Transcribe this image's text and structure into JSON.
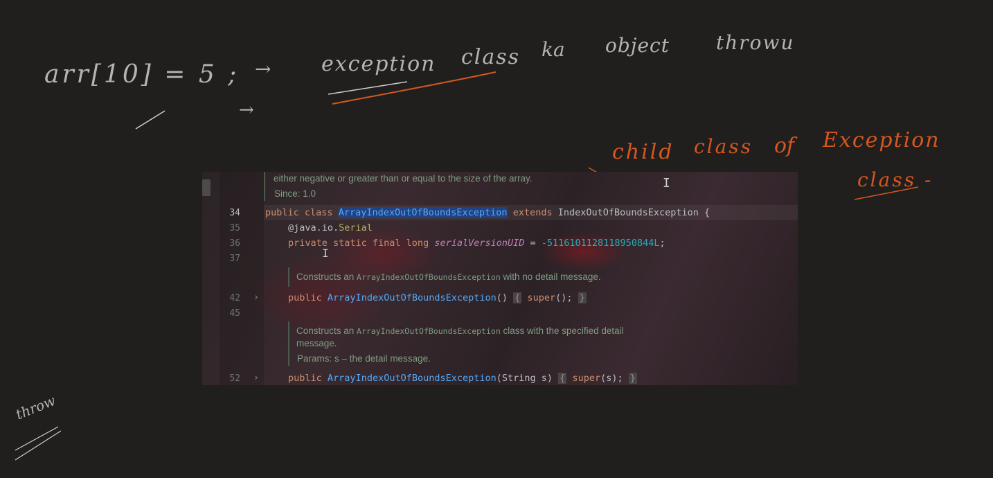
{
  "handwriting": {
    "line1_left": "arr[10] = 5 ;",
    "arrow": "→",
    "exception": "exception",
    "class": "class",
    "ka": "ka",
    "object": "object",
    "thrown": "throwu",
    "child": "child",
    "class2": "class",
    "of": "of",
    "Exception": "Exception",
    "class3": "class -",
    "throw": "throw"
  },
  "editor": {
    "doc_top_line1": "either negative or greater than or equal to the size of the array.",
    "doc_top_line2": "Since: 1.0",
    "line_numbers": [
      "34",
      "35",
      "36",
      "37",
      "42",
      "45",
      "52"
    ],
    "line34": {
      "kw1": "public",
      "kw2": "class",
      "name": "ArrayIndexOutOfBoundsException",
      "kw3": "extends",
      "parent": "IndexOutOfBoundsException {"
    },
    "line35": {
      "prefix": "@java.io.",
      "ann": "Serial"
    },
    "line36": {
      "kw": "private static final long",
      "field": "serialVersionUID",
      "eq": " = ",
      "num": "-5116101128118950844L",
      "semi": ";"
    },
    "doc1": {
      "pre": "Constructs an ",
      "code": "ArrayIndexOutOfBoundsException",
      "post": " with no detail message."
    },
    "line42": {
      "kw": "public",
      "name": "ArrayIndexOutOfBoundsException",
      "args": "()",
      "body_open": "{",
      "super": "super",
      "call": "();",
      "body_close": "}"
    },
    "doc2": {
      "pre": "Constructs an ",
      "code": "ArrayIndexOutOfBoundsException",
      "post": " class with the specified detail",
      "line2": "message.",
      "params": "Params: s – the detail message."
    },
    "line52": {
      "kw": "public",
      "name": "ArrayIndexOutOfBoundsException",
      "args": "(String s)",
      "body_open": "{",
      "super": "super",
      "call": "(s);",
      "body_close": "}"
    }
  },
  "colors": {
    "background": "#211f1e",
    "ink_orange": "#d4581f",
    "ink_white": "#cfcfcf",
    "selection": "#214283"
  }
}
